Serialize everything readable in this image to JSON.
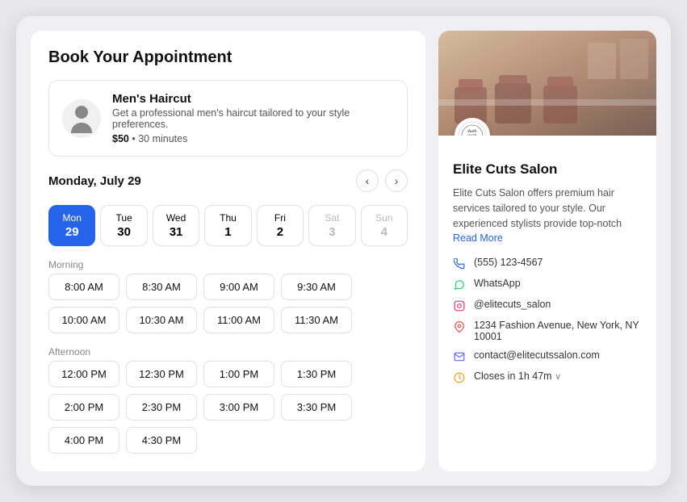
{
  "page": {
    "title": "Book Your Appointment"
  },
  "service": {
    "name": "Men's Haircut",
    "description": "Get a professional men's haircut tailored to your style preferences.",
    "price": "$50",
    "duration": "30 minutes"
  },
  "calendar": {
    "current_date_label": "Monday, July 29",
    "days": [
      {
        "name": "Mon",
        "num": "29",
        "active": true,
        "disabled": false
      },
      {
        "name": "Tue",
        "num": "30",
        "active": false,
        "disabled": false
      },
      {
        "name": "Wed",
        "num": "31",
        "active": false,
        "disabled": false
      },
      {
        "name": "Thu",
        "num": "1",
        "active": false,
        "disabled": false
      },
      {
        "name": "Fri",
        "num": "2",
        "active": false,
        "disabled": false
      },
      {
        "name": "Sat",
        "num": "3",
        "active": false,
        "disabled": true
      },
      {
        "name": "Sun",
        "num": "4",
        "active": false,
        "disabled": true
      }
    ],
    "morning_label": "Morning",
    "afternoon_label": "Afternoon",
    "morning_slots": [
      "8:00 AM",
      "8:30 AM",
      "9:00 AM",
      "9:30 AM",
      "10:00 AM",
      "10:30 AM",
      "11:00 AM",
      "11:30 AM"
    ],
    "afternoon_slots": [
      "12:00 PM",
      "12:30 PM",
      "1:00 PM",
      "1:30 PM",
      "2:00 PM",
      "2:30 PM",
      "3:00 PM",
      "3:30 PM",
      "4:00 PM",
      "4:30 PM"
    ]
  },
  "salon": {
    "name": "Elite Cuts Salon",
    "description": "Elite Cuts Salon offers premium hair services tailored to your style. Our experienced stylists provide top-notch",
    "read_more": "Read More",
    "logo_text": "ELITE CUTS SALON",
    "phone": "(555) 123-4567",
    "whatsapp": "WhatsApp",
    "instagram": "@elitecuts_salon",
    "address": "1234 Fashion Avenue, New York, NY 10001",
    "email": "contact@elitecutssalon.com",
    "hours": "Closes in 1h 47m",
    "hours_chevron": "∨"
  },
  "icons": {
    "phone": "📞",
    "whatsapp": "💬",
    "instagram": "📷",
    "location": "📍",
    "email": "✉",
    "clock": "🕐"
  }
}
